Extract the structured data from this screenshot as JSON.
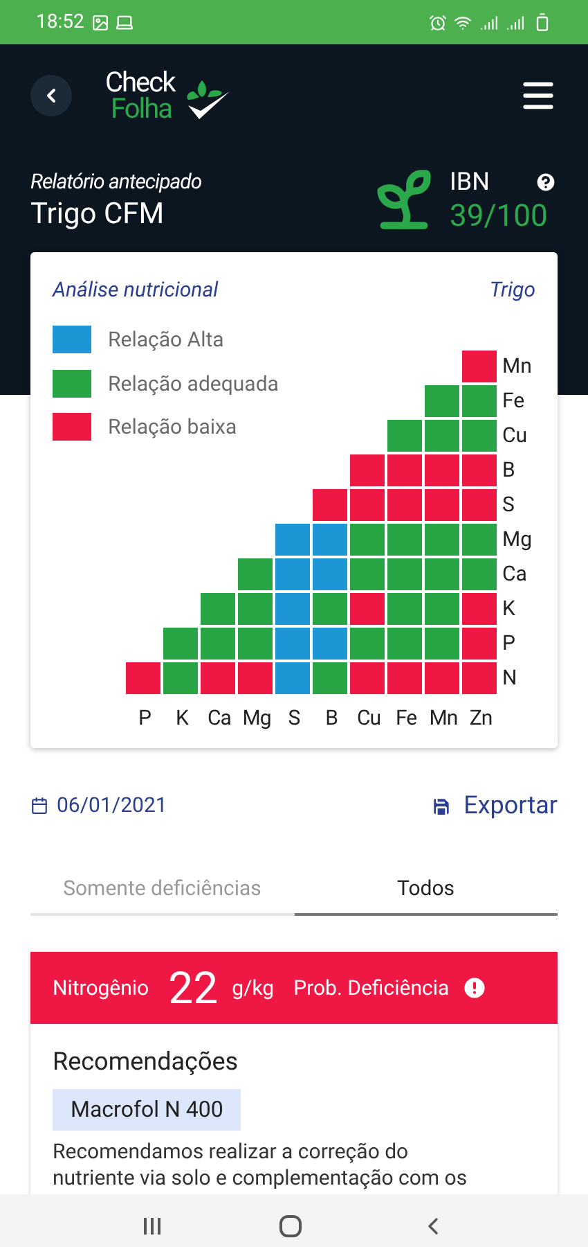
{
  "status_bar": {
    "time": "18:52"
  },
  "header": {
    "logo_top": "Check",
    "logo_bottom": "Folha"
  },
  "report": {
    "subtitle": "Relatório antecipado",
    "title": "Trigo CFM",
    "ibn_label": "IBN",
    "ibn_value": "39/100"
  },
  "analysis": {
    "title": "Análise nutricional",
    "crop": "Trigo",
    "legend": [
      {
        "kind": "alta",
        "label": "Relação Alta",
        "color": "#1e96d6"
      },
      {
        "kind": "adequada",
        "label": "Relação adequada",
        "color": "#27a444"
      },
      {
        "kind": "baixa",
        "label": "Relação baixa",
        "color": "#ef1844"
      }
    ],
    "rows": [
      {
        "label": "Mn",
        "cells": [
          {
            "kind": "baixa"
          }
        ]
      },
      {
        "label": "Fe",
        "cells": [
          {
            "kind": "adequada"
          },
          {
            "kind": "adequada"
          }
        ]
      },
      {
        "label": "Cu",
        "cells": [
          {
            "kind": "adequada"
          },
          {
            "kind": "adequada"
          },
          {
            "kind": "adequada"
          }
        ]
      },
      {
        "label": "B",
        "cells": [
          {
            "kind": "baixa"
          },
          {
            "kind": "baixa"
          },
          {
            "kind": "baixa"
          },
          {
            "kind": "baixa"
          }
        ]
      },
      {
        "label": "S",
        "cells": [
          {
            "kind": "baixa"
          },
          {
            "kind": "baixa"
          },
          {
            "kind": "baixa"
          },
          {
            "kind": "baixa"
          },
          {
            "kind": "baixa"
          }
        ]
      },
      {
        "label": "Mg",
        "cells": [
          {
            "kind": "alta"
          },
          {
            "kind": "alta"
          },
          {
            "kind": "adequada"
          },
          {
            "kind": "adequada"
          },
          {
            "kind": "adequada"
          },
          {
            "kind": "adequada"
          }
        ]
      },
      {
        "label": "Ca",
        "cells": [
          {
            "kind": "adequada"
          },
          {
            "kind": "alta"
          },
          {
            "kind": "alta"
          },
          {
            "kind": "adequada"
          },
          {
            "kind": "adequada"
          },
          {
            "kind": "adequada"
          },
          {
            "kind": "adequada"
          }
        ]
      },
      {
        "label": "K",
        "cells": [
          {
            "kind": "adequada"
          },
          {
            "kind": "adequada"
          },
          {
            "kind": "alta"
          },
          {
            "kind": "adequada"
          },
          {
            "kind": "baixa"
          },
          {
            "kind": "adequada"
          },
          {
            "kind": "adequada"
          },
          {
            "kind": "baixa"
          }
        ]
      },
      {
        "label": "P",
        "cells": [
          {
            "kind": "adequada"
          },
          {
            "kind": "adequada"
          },
          {
            "kind": "adequada"
          },
          {
            "kind": "alta"
          },
          {
            "kind": "alta"
          },
          {
            "kind": "adequada"
          },
          {
            "kind": "adequada"
          },
          {
            "kind": "adequada"
          },
          {
            "kind": "baixa"
          }
        ]
      },
      {
        "label": "N",
        "cells": [
          {
            "kind": "baixa"
          },
          {
            "kind": "adequada"
          },
          {
            "kind": "baixa"
          },
          {
            "kind": "baixa"
          },
          {
            "kind": "alta"
          },
          {
            "kind": "adequada"
          },
          {
            "kind": "baixa"
          },
          {
            "kind": "baixa"
          },
          {
            "kind": "baixa"
          },
          {
            "kind": "baixa"
          }
        ]
      }
    ],
    "columns": [
      "P",
      "K",
      "Ca",
      "Mg",
      "S",
      "B",
      "Cu",
      "Fe",
      "Mn",
      "Zn"
    ]
  },
  "date": "06/01/2021",
  "export_button": "Exportar",
  "tabs": [
    {
      "label": "Somente deficiências",
      "selected": false
    },
    {
      "label": "Todos",
      "selected": true
    }
  ],
  "nutrient": {
    "name": "Nitrogênio",
    "value": "22",
    "unit": "g/kg",
    "status": "Prob. Deficiência",
    "section_title": "Recomendações",
    "product": "Macrofol N 400",
    "text": "Recomendamos realizar a correção do nutriente via solo e complementação com os"
  }
}
